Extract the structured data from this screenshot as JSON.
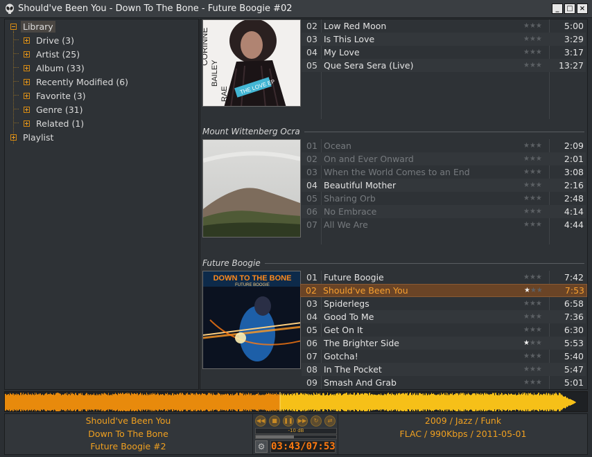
{
  "window": {
    "title": "Should've Been You - Down To The Bone - Future Boogie #02",
    "buttons": {
      "minimize": "_",
      "maximize": "□",
      "close": "×"
    }
  },
  "tree": {
    "root": "Library",
    "items": [
      {
        "label": "Drive (3)"
      },
      {
        "label": "Artist (25)"
      },
      {
        "label": "Album (33)"
      },
      {
        "label": "Recently Modified (6)"
      },
      {
        "label": "Favorite (3)"
      },
      {
        "label": "Genre (31)"
      },
      {
        "label": "Related (1)"
      }
    ],
    "playlist": "Playlist"
  },
  "groups": [
    {
      "title": "",
      "cover_text": [
        "CORINNE",
        "BAILEY",
        "RAE",
        "THE LOVE EP"
      ],
      "tracks": [
        {
          "num": "02",
          "name": "Low Red Moon",
          "rating": 0,
          "duration": "5:00",
          "dim": false
        },
        {
          "num": "03",
          "name": "Is This Love",
          "rating": 0,
          "duration": "3:29",
          "dim": false
        },
        {
          "num": "04",
          "name": "My Love",
          "rating": 0,
          "duration": "3:17",
          "dim": false
        },
        {
          "num": "05",
          "name": "Que Sera Sera (Live)",
          "rating": 0,
          "duration": "13:27",
          "dim": false
        }
      ]
    },
    {
      "title": "Mount Wittenberg Ocra",
      "tracks": [
        {
          "num": "01",
          "name": "Ocean",
          "rating": 0,
          "duration": "2:09",
          "dim": true
        },
        {
          "num": "02",
          "name": "On and Ever Onward",
          "rating": 0,
          "duration": "2:01",
          "dim": true
        },
        {
          "num": "03",
          "name": "When the World Comes to an End",
          "rating": 0,
          "duration": "3:08",
          "dim": true
        },
        {
          "num": "04",
          "name": "Beautiful Mother",
          "rating": 0,
          "duration": "2:16",
          "dim": false
        },
        {
          "num": "05",
          "name": "Sharing Orb",
          "rating": 0,
          "duration": "2:48",
          "dim": true
        },
        {
          "num": "06",
          "name": "No Embrace",
          "rating": 0,
          "duration": "4:14",
          "dim": true
        },
        {
          "num": "07",
          "name": "All We Are",
          "rating": 0,
          "duration": "4:44",
          "dim": true
        }
      ]
    },
    {
      "title": "Future Boogie",
      "cover_text": [
        "DOWN TO THE BONE",
        "FUTURE BOOGIE"
      ],
      "tracks": [
        {
          "num": "01",
          "name": "Future Boogie",
          "rating": 0,
          "duration": "7:42",
          "dim": false
        },
        {
          "num": "02",
          "name": "Should've Been You",
          "rating": 1,
          "duration": "7:53",
          "dim": false,
          "playing": true
        },
        {
          "num": "03",
          "name": "Spiderlegs",
          "rating": 0,
          "duration": "6:58",
          "dim": false
        },
        {
          "num": "04",
          "name": "Good To Me",
          "rating": 0,
          "duration": "7:36",
          "dim": false
        },
        {
          "num": "05",
          "name": "Get On It",
          "rating": 0,
          "duration": "6:30",
          "dim": false
        },
        {
          "num": "06",
          "name": "The Brighter Side",
          "rating": 1,
          "duration": "5:53",
          "dim": false
        },
        {
          "num": "07",
          "name": "Gotcha!",
          "rating": 0,
          "duration": "5:40",
          "dim": false
        },
        {
          "num": "08",
          "name": "In The Pocket",
          "rating": 0,
          "duration": "5:47",
          "dim": false
        },
        {
          "num": "09",
          "name": "Smash And Grab",
          "rating": 0,
          "duration": "5:01",
          "dim": false
        }
      ]
    }
  ],
  "now_playing": {
    "title": "Should've Been You",
    "artist": "Down To The Bone",
    "album": "Future Boogie #2",
    "meta1": "2009 / Jazz /  Funk",
    "meta2": "FLAC / 990Kbps / 2011-05-01",
    "volume_label": "-10 dB",
    "time": "03:43/07:53",
    "progress_fraction": 0.472
  },
  "colors": {
    "accent": "#f0a020",
    "playing_row": "#6a4426",
    "time_digits": "#ff7a10"
  }
}
